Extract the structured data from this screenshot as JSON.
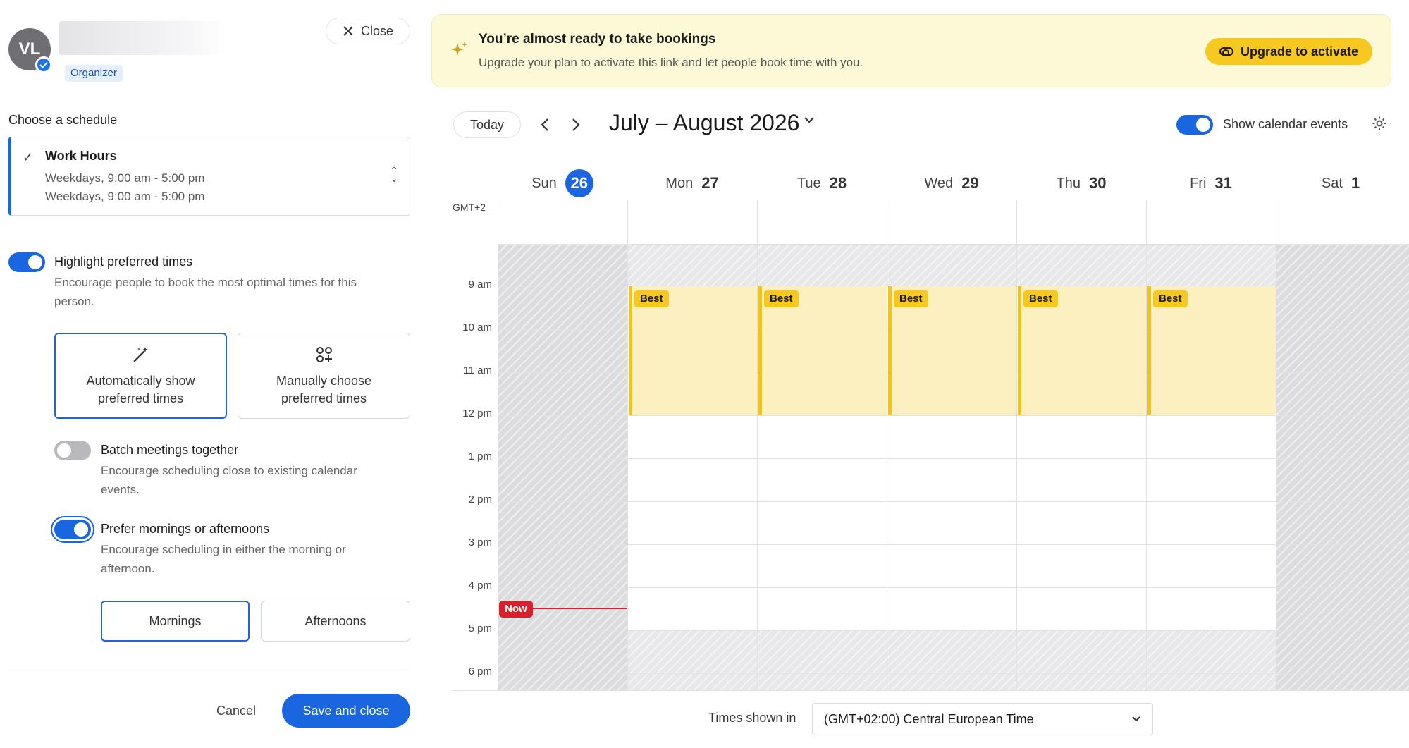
{
  "organizer": {
    "initials": "VL",
    "badge": "Organizer"
  },
  "close_label": "Close",
  "schedule": {
    "section_label": "Choose a schedule",
    "title": "Work Hours",
    "line1": "Weekdays, 9:00 am - 5:00 pm",
    "line2": "Weekdays, 9:00 am - 5:00 pm"
  },
  "highlight": {
    "title": "Highlight preferred times",
    "desc_line1": "Encourage people to book the most optimal times for this",
    "desc_line2": "person.",
    "enabled": true,
    "auto_line1": "Automatically show",
    "auto_line2": "preferred times",
    "manual_line1": "Manually choose",
    "manual_line2": "preferred times"
  },
  "batch": {
    "title": "Batch meetings together",
    "desc_line1": "Encourage scheduling close to existing calendar",
    "desc_line2": "events.",
    "enabled": false
  },
  "prefer": {
    "title": "Prefer mornings or afternoons",
    "desc_line1": "Encourage scheduling in either the morning or",
    "desc_line2": "afternoon.",
    "enabled": true,
    "mornings": "Mornings",
    "afternoons": "Afternoons"
  },
  "footer": {
    "cancel": "Cancel",
    "save": "Save and close"
  },
  "banner": {
    "title": "You’re almost ready to take bookings",
    "subtitle": "Upgrade your plan to activate this link and let people book time with you.",
    "button": "Upgrade to activate"
  },
  "calendar": {
    "today_label": "Today",
    "range_title": "July – August 2026",
    "show_events_label": "Show calendar events",
    "tz_abbrev": "GMT+2",
    "days": [
      {
        "name": "Sun",
        "num": "26"
      },
      {
        "name": "Mon",
        "num": "27"
      },
      {
        "name": "Tue",
        "num": "28"
      },
      {
        "name": "Wed",
        "num": "29"
      },
      {
        "name": "Thu",
        "num": "30"
      },
      {
        "name": "Fri",
        "num": "31"
      },
      {
        "name": "Sat",
        "num": "1"
      }
    ],
    "hours": [
      "9 am",
      "10 am",
      "11 am",
      "12 pm",
      "1 pm",
      "2 pm",
      "3 pm",
      "4 pm",
      "5 pm",
      "6 pm"
    ],
    "best_label": "Best",
    "now_label": "Now"
  },
  "timezone": {
    "label": "Times shown in",
    "value": "(GMT+02:00) Central European Time"
  },
  "colors": {
    "accent": "#1a66e0",
    "best": "#f7c920",
    "now": "#d8202c"
  }
}
